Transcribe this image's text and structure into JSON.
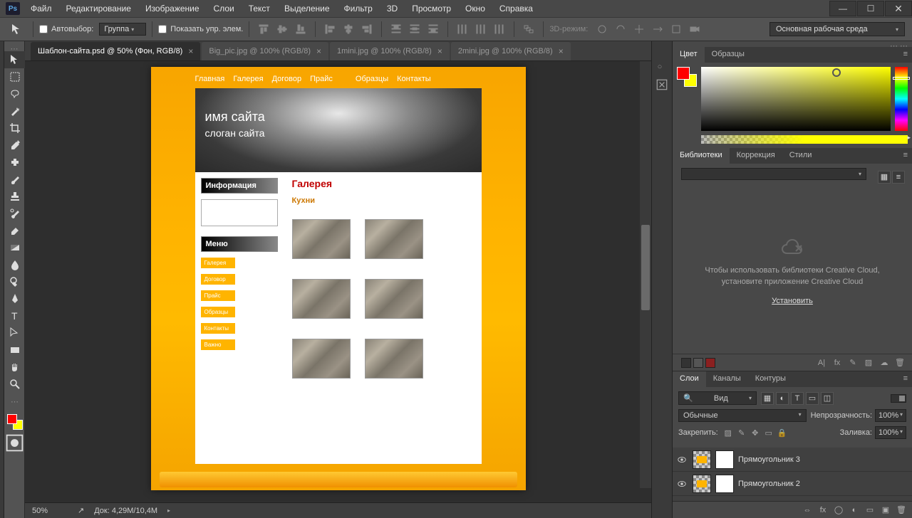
{
  "menubar": [
    "Файл",
    "Редактирование",
    "Изображение",
    "Слои",
    "Текст",
    "Выделение",
    "Фильтр",
    "3D",
    "Просмотр",
    "Окно",
    "Справка"
  ],
  "options": {
    "autoselect_label": "Автовыбор:",
    "autoselect_group": "Группа",
    "show_controls": "Показать упр. элем.",
    "mode3d_label": "3D-режим:",
    "workspace": "Основная рабочая среда"
  },
  "doctabs": [
    {
      "label": "Шаблон-сайта.psd @ 50% (Фон, RGB/8)",
      "active": true
    },
    {
      "label": "Big_pic.jpg @ 100% (RGB/8)",
      "active": false
    },
    {
      "label": "1mini.jpg @ 100% (RGB/8)",
      "active": false
    },
    {
      "label": "2mini.jpg @ 100% (RGB/8)",
      "active": false
    }
  ],
  "site": {
    "nav": [
      "Главная",
      "Галерея",
      "Договор",
      "Прайс",
      "Образцы",
      "Контакты"
    ],
    "hero_title": "имя сайта",
    "hero_slogan": "слоган сайта",
    "info_head": "Информация",
    "menu_head": "Меню",
    "menu_items": [
      "Галерея",
      "Договор",
      "Прайс",
      "Образцы",
      "Контакты",
      "Важно"
    ],
    "h1": "Галерея",
    "h2": "Кухни"
  },
  "status": {
    "zoom": "50%",
    "doc_info": "Док: 4,29M/10,4M"
  },
  "panels": {
    "color_tabs": [
      "Цвет",
      "Образцы"
    ],
    "lib_tabs": [
      "Библиотеки",
      "Коррекция",
      "Стили"
    ],
    "lib_msg": "Чтобы использовать библиотеки Creative Cloud, установите приложение Creative Cloud",
    "lib_link": "Установить",
    "layers_tabs": [
      "Слои",
      "Каналы",
      "Контуры"
    ],
    "layers_filter": "Вид",
    "blend_mode": "Обычные",
    "opacity_label": "Непрозрачность:",
    "opacity_val": "100%",
    "lock_label": "Закрепить:",
    "fill_label": "Заливка:",
    "fill_val": "100%",
    "layers": [
      "Прямоугольник 3",
      "Прямоугольник 2"
    ]
  },
  "swatches": {
    "fg": "#ff0000",
    "bg": "#ffff00"
  },
  "lib_footer_colors": [
    "#333333",
    "#555555",
    "#8b2020"
  ]
}
